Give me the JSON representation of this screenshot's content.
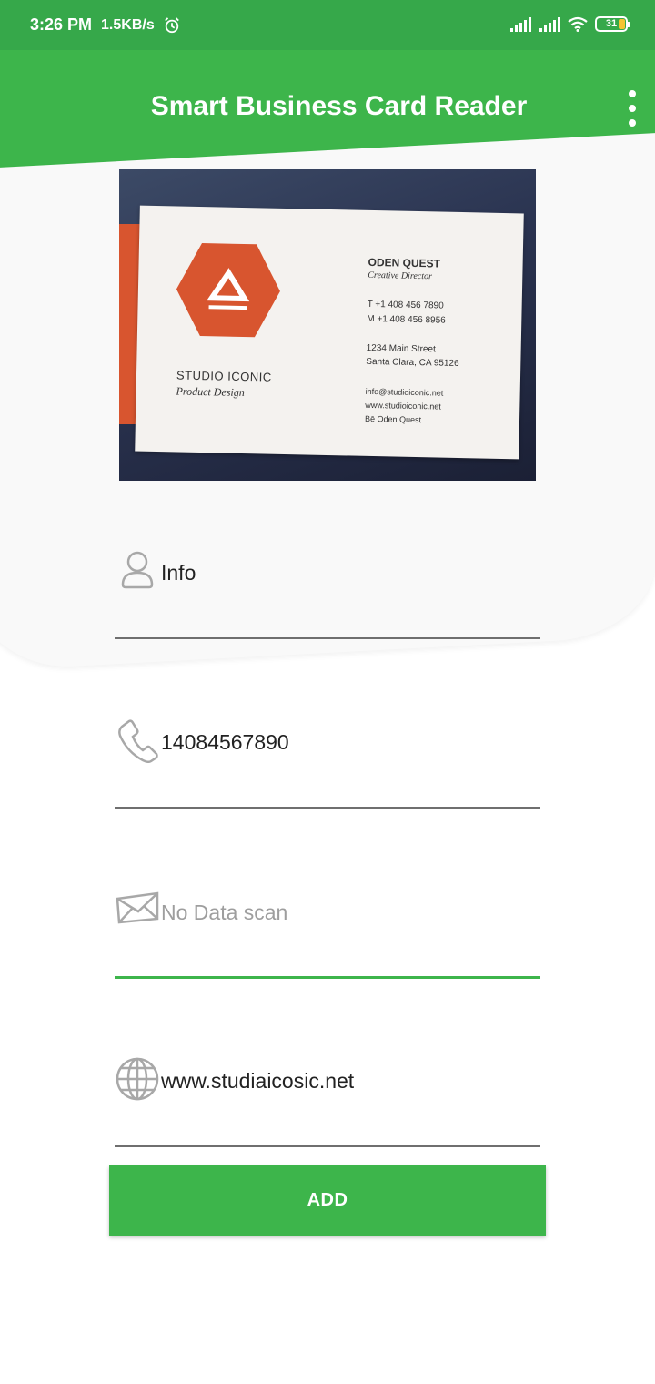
{
  "status_bar": {
    "time": "3:26 PM",
    "speed": "1.5KB/s",
    "battery": "31"
  },
  "app_bar": {
    "title": "Smart Business Card Reader",
    "menu_icon": "more-vert-icon"
  },
  "scanned_card": {
    "brand": "STUDIO ICONIC",
    "tagline": "Product Design",
    "person_name": "ODEN QUEST",
    "person_role": "Creative Director",
    "phone_t": "T   +1 408 456 7890",
    "phone_m": "M   +1 408 456 8956",
    "address_line1": "1234 Main Street",
    "address_line2": "Santa Clara, CA 95126",
    "email": "info@studioiconic.net",
    "website": "www.studioiconic.net",
    "social": "Bē   Oden Quest",
    "accent_color": "#d8552f"
  },
  "form": {
    "fields": [
      {
        "icon": "person-icon",
        "value": "Info",
        "is_placeholder": false
      },
      {
        "icon": "phone-icon",
        "value": "14084567890",
        "is_placeholder": false
      },
      {
        "icon": "mail-icon",
        "value": "No Data scan",
        "is_placeholder": true
      },
      {
        "icon": "globe-icon",
        "value": "www.studiaicosic.net",
        "is_placeholder": false
      }
    ],
    "add_label": "ADD"
  },
  "colors": {
    "status_bar": "#36a84a",
    "primary": "#3db54b",
    "text": "#222222",
    "placeholder": "#9e9e9e"
  }
}
